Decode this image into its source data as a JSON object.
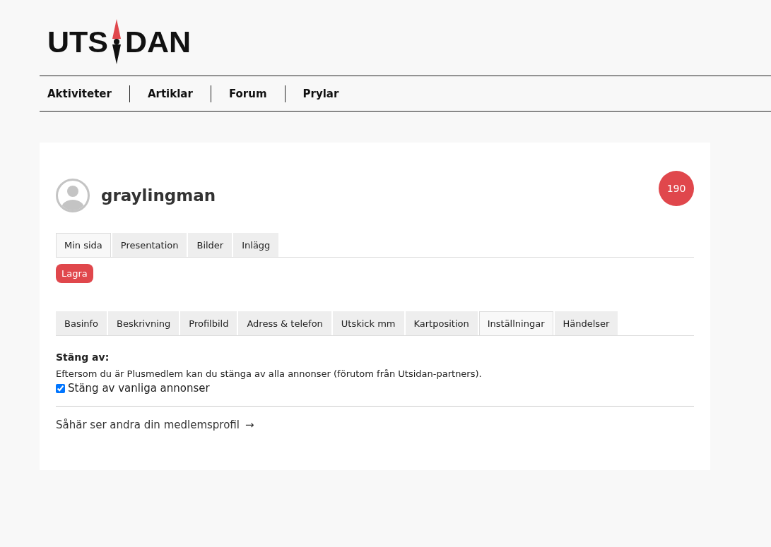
{
  "logo": {
    "left": "UTS",
    "right": "DAN"
  },
  "nav": [
    {
      "label": "Aktiviteter"
    },
    {
      "label": "Artiklar"
    },
    {
      "label": "Forum"
    },
    {
      "label": "Prylar"
    }
  ],
  "profile": {
    "username": "graylingman",
    "badge": "190"
  },
  "tabs": [
    {
      "label": "Min sida",
      "selected": true
    },
    {
      "label": "Presentation",
      "selected": false
    },
    {
      "label": "Bilder",
      "selected": false
    },
    {
      "label": "Inlägg",
      "selected": false
    }
  ],
  "save_button": "Lagra",
  "subtabs": [
    {
      "label": "Basinfo",
      "selected": false
    },
    {
      "label": "Beskrivning",
      "selected": false
    },
    {
      "label": "Profilbild",
      "selected": false
    },
    {
      "label": "Adress & telefon",
      "selected": false
    },
    {
      "label": "Utskick mm",
      "selected": false
    },
    {
      "label": "Kartposition",
      "selected": false
    },
    {
      "label": "Inställningar",
      "selected": true
    },
    {
      "label": "Händelser",
      "selected": false
    }
  ],
  "settings": {
    "heading": "Stäng av:",
    "description": "Eftersom du är Plusmedlem kan du stänga av alla annonser (förutom från Utsidan-partners).",
    "checkbox": {
      "label": "Stäng av vanliga annonser",
      "checked": true
    }
  },
  "profile_link": {
    "label": "Såhär ser andra din medlemsprofil",
    "arrow": "→"
  }
}
